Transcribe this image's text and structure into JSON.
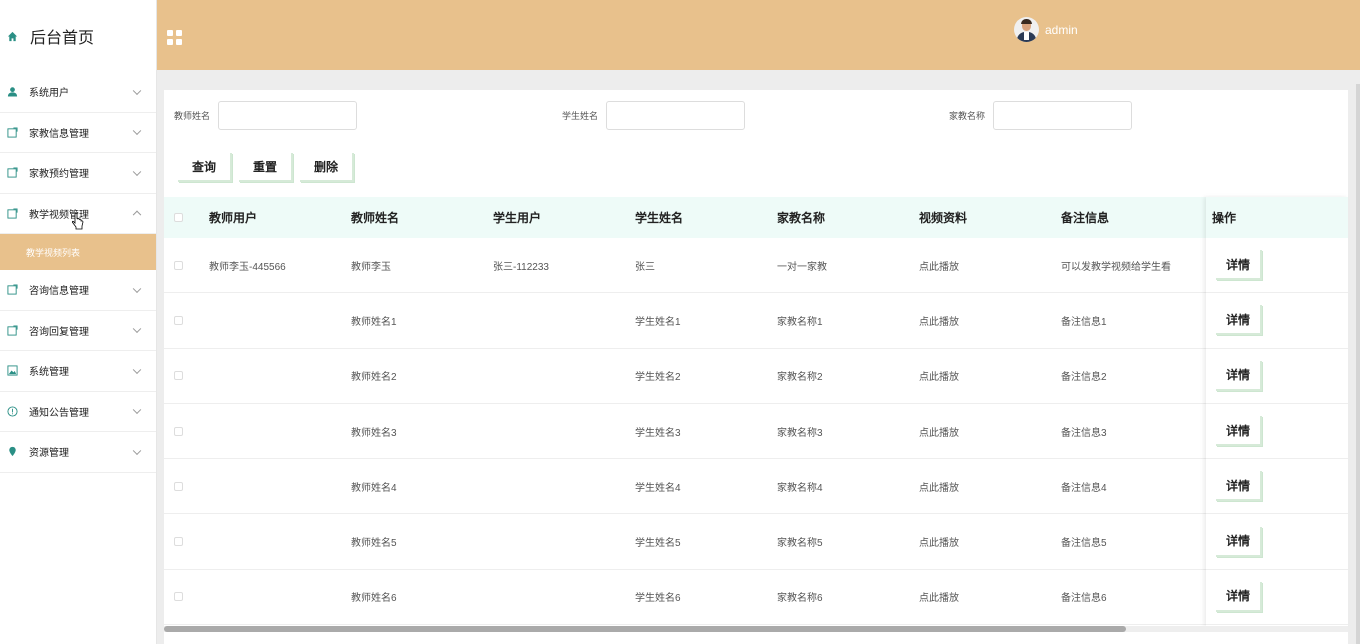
{
  "sidebar": {
    "brand": "后台首页",
    "items": [
      {
        "label": "系统用户",
        "icon": "user-icon"
      },
      {
        "label": "家教信息管理",
        "icon": "edit-icon"
      },
      {
        "label": "家教预约管理",
        "icon": "edit-icon"
      },
      {
        "label": "教学视频管理",
        "icon": "edit-icon",
        "expanded": true
      },
      {
        "label": "咨询信息管理",
        "icon": "edit-icon"
      },
      {
        "label": "咨询回复管理",
        "icon": "edit-icon"
      },
      {
        "label": "系统管理",
        "icon": "image-icon"
      },
      {
        "label": "通知公告管理",
        "icon": "info-icon"
      },
      {
        "label": "资源管理",
        "icon": "location-icon"
      }
    ],
    "sub_item": "教学视频列表"
  },
  "header": {
    "username": "admin"
  },
  "search": {
    "teacher_label": "教师姓名",
    "teacher_value": "",
    "student_label": "学生姓名",
    "student_value": "",
    "tutor_label": "家教名称",
    "tutor_value": ""
  },
  "buttons": {
    "query": "查询",
    "reset": "重置",
    "delete": "删除"
  },
  "table": {
    "columns": [
      "教师用户",
      "教师姓名",
      "学生用户",
      "学生姓名",
      "家教名称",
      "视频资料",
      "备注信息"
    ],
    "ops_header": "操作",
    "detail": "详情",
    "rows": [
      [
        "教师李玉-445566",
        "教师李玉",
        "张三-112233",
        "张三",
        "一对一家教",
        "点此播放",
        "可以发教学视频给学生看"
      ],
      [
        "",
        "教师姓名1",
        "",
        "学生姓名1",
        "家教名称1",
        "点此播放",
        "备注信息1"
      ],
      [
        "",
        "教师姓名2",
        "",
        "学生姓名2",
        "家教名称2",
        "点此播放",
        "备注信息2"
      ],
      [
        "",
        "教师姓名3",
        "",
        "学生姓名3",
        "家教名称3",
        "点此播放",
        "备注信息3"
      ],
      [
        "",
        "教师姓名4",
        "",
        "学生姓名4",
        "家教名称4",
        "点此播放",
        "备注信息4"
      ],
      [
        "",
        "教师姓名5",
        "",
        "学生姓名5",
        "家教名称5",
        "点此播放",
        "备注信息5"
      ],
      [
        "",
        "教师姓名6",
        "",
        "学生姓名6",
        "家教名称6",
        "点此播放",
        "备注信息6"
      ]
    ]
  },
  "colors": {
    "accent": "#e8c18c",
    "table_header_bg": "#eefbf8"
  }
}
